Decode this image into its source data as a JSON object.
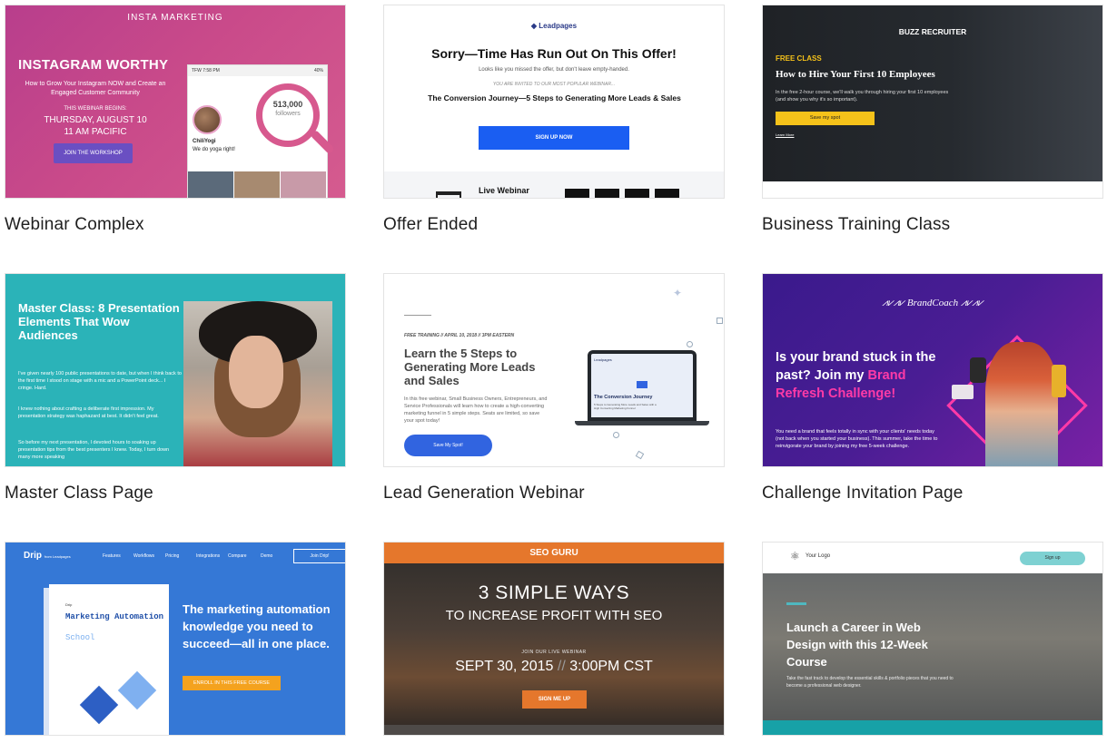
{
  "templates": [
    {
      "title": "Webinar Complex",
      "preview": {
        "brand": "INSTA MARKETING",
        "headline": "INSTAGRAM WORTHY",
        "subhead": "How to Grow Your Instagram NOW and Create an Engaged Customer Community",
        "begins": "THIS WEBINAR BEGINS:",
        "date": "THURSDAY, AUGUST 10",
        "time": "11 AM PACIFIC",
        "button": "JOIN THE WORKSHOP",
        "followers_count": "513,000",
        "followers_label": "followers",
        "profile_name": "ChiliYogi",
        "profile_bio": "We do yoga right!",
        "status_bar": "TFW   7:58 PM",
        "battery": "40%"
      }
    },
    {
      "title": "Offer Ended",
      "preview": {
        "logo": "Leadpages",
        "headline": "Sorry—Time Has Run Out On This Offer!",
        "line1": "Looks like you missed the offer, but don't leave empty-handed.",
        "line2": "YOU ARE INVITED TO OUR MOST POPULAR WEBINAR...",
        "line3": "The Conversion Journey—5 Steps to Generating More Leads & Sales",
        "button": "SIGN UP NOW",
        "webinar_label": "Live Webinar"
      }
    },
    {
      "title": "Business Training Class",
      "preview": {
        "brand": "BUZZ RECRUITER",
        "kicker": "FREE CLASS",
        "headline": "How to Hire Your First 10 Employees",
        "desc": "In the free 2-hour course, we'll walk you through hiring your first 10 employees (and show you why it's so important).",
        "button": "Save my spot",
        "link": "Learn More"
      }
    },
    {
      "title": "Master Class Page",
      "preview": {
        "headline": "Master Class: 8 Presentation Elements That Wow Audiences",
        "p1": "I've given nearly 100 public presentations to date, but when I think back to the first time I stood on stage with a mic and a PowerPoint deck... I cringe. Hard.",
        "p2": "I knew nothing about crafting a deliberate first impression. My presentation strategy was haphazard at best. It didn't feel great.",
        "p3": "So before my next presentation, I devoted hours to soaking up presentation tips from the best presenters I knew. Today, I turn down many more speaking"
      }
    },
    {
      "title": "Lead Generation Webinar",
      "preview": {
        "pre": "FREE TRAINING // APRIL 10, 2018 // 3PM EASTERN",
        "headline": "Learn the 5 Steps to Generating More Leads and Sales",
        "desc": "In this free webinar, Small Business Owners, Entrepreneurs, and Service Professionals will learn how to create a high-converting marketing funnel in 5 simple steps. Seats are limited, so save your spot today!",
        "button": "Save My Spot!",
        "screen_logo": "Leadpages",
        "screen_title": "The Conversion Journey",
        "screen_sub": "5 Steps to Generating More Leads and Sales with a High Converting Marketing Funnel"
      }
    },
    {
      "title": "Challenge Invitation Page",
      "preview": {
        "brand": "BrandCoach",
        "headline_a": "Is your brand stuck in the past? Join my",
        "headline_b": "Brand Refresh Challenge!",
        "desc": "You need a brand that feels totally in sync with your clients' needs today (not back when you started your business). This summer, take the time to reinvigorate your brand by joining my free 5-week challenge."
      }
    },
    {
      "title": "",
      "preview": {
        "logo": "Drip",
        "logo_sub": "from Leadpages",
        "nav": [
          "Features",
          "Workflows",
          "Pricing",
          "Integrations",
          "Compare",
          "Demo"
        ],
        "join": "Join Drip!",
        "book_logo": "Drip",
        "book_title": "Marketing Automation",
        "book_sub": "School",
        "headline": "The marketing automation knowledge you need to succeed—all in one place.",
        "button": "ENROLL IN THIS FREE COURSE"
      }
    },
    {
      "title": "",
      "preview": {
        "brand": "SEO GURU",
        "headline1": "3 SIMPLE WAYS",
        "headline2": "TO INCREASE PROFIT WITH SEO",
        "join": "JOIN OUR LIVE WEBINAR",
        "date": "SEPT 30, 2015",
        "separator": "//",
        "time": "3:00PM CST",
        "button": "SIGN ME UP"
      }
    },
    {
      "title": "",
      "preview": {
        "logo": "Your Logo",
        "signup": "Sign up",
        "headline": "Launch a Career in Web Design with this 12-Week Course",
        "desc": "Take the fast track to develop the essential skills & portfolio pieces that you need to become a professional web designer."
      }
    }
  ],
  "colors": {
    "instagram_pink": "#c94a8a",
    "leadpages_blue": "#1a5ef2",
    "buzz_yellow": "#f5c21a",
    "masterclass_teal": "#2bb3b8",
    "challenge_purple": "#4a1d94",
    "challenge_pink": "#ff3aa7",
    "drip_blue": "#3578d6",
    "seo_orange": "#e5772c",
    "career_teal": "#17a1a7"
  }
}
